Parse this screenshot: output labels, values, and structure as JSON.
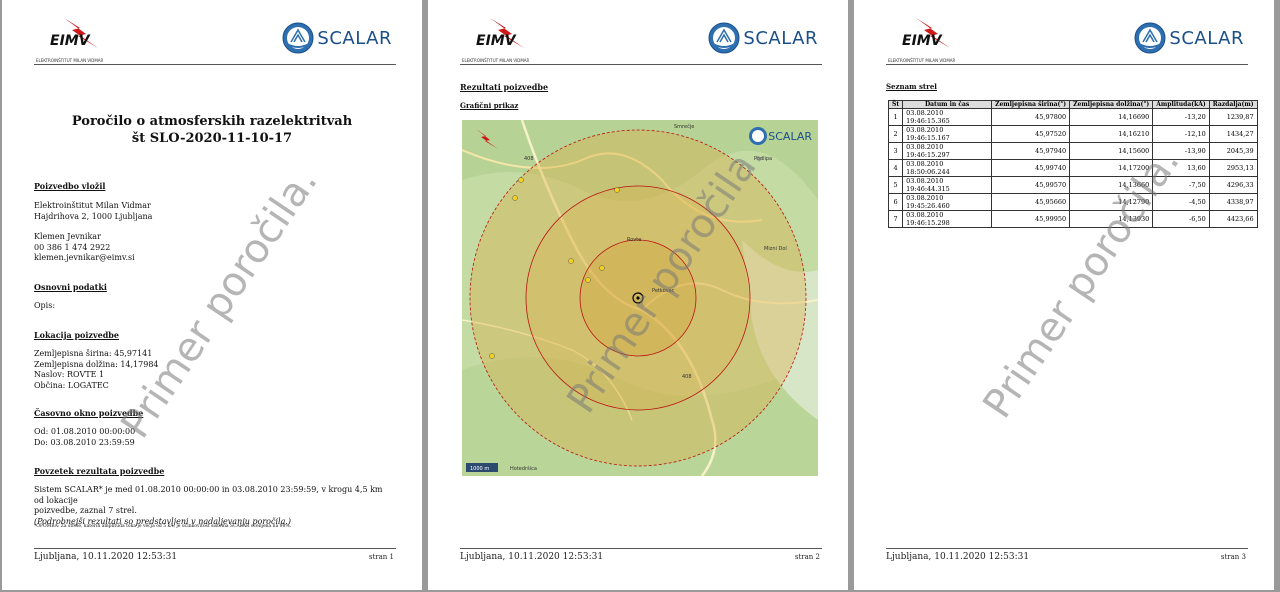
{
  "brand": {
    "eimv": "EIMV",
    "eimv_sub": "ELEKTROINŠTITUT MILAN VIDMAR",
    "scalar": "SCALAR"
  },
  "watermark": "Primer poročila.",
  "page1": {
    "title_line1": "Poročilo o atmosferskih razelektritvah",
    "title_line2": "št SLO-2020-11-10-17",
    "sec_requester": "Poizvedbo vložil",
    "requester_lines": [
      "Elektroinštitut Milan Vidmar",
      "Hajdrihova 2, 1000 Ljubljana"
    ],
    "contact_lines": [
      "Klemen Jevnikar",
      "00 386 1 474 2922",
      "klemen.jevnikar@eimv.si"
    ],
    "sec_basic": "Osnovni podatki",
    "opis": "Opis:",
    "sec_location": "Lokacija poizvedbe",
    "location_lines": [
      "Zemljepisna širina: 45,97141",
      "Zemljepisna dolžina: 14,17984",
      "Naslov: ROVTE 1",
      "Občina: LOGATEC"
    ],
    "sec_time": "Časovno okno poizvedbe",
    "time_lines": [
      "Od: 01.08.2010 00:00:00",
      "Do: 03.08.2010 23:59:59"
    ],
    "sec_summary": "Povzetek rezultata poizvedbe",
    "summary_lines": [
      "Sistem SCALAR* je med 01.08.2010 00:00:00 in 03.08.2010 23:59:59, v krogu 4,5 km od lokacije",
      "poizvedbe, zaznal 7 strel."
    ],
    "summary_italic": "(Podrobnejši rezultati so predstavljeni v nadaljevanju poročila.)",
    "note": "*OPOMBA: Za strele, katerih amplituda toka je večja od 5 kA, je učinkovitost sistema SCALAR ocenjena na 98%.",
    "footer_left": "Ljubljana, 10.11.2020 12:53:31",
    "footer_right": "stran 1"
  },
  "page2": {
    "sec_results": "Rezultati poizvedbe",
    "sec_graphic": "Grafični prikaz",
    "map_labels": {
      "road_top": "408",
      "road_bottom": "408",
      "town_center": "Rovte",
      "town_right": "Mizni Dol",
      "town_ne": "Podlipa",
      "town_mid": "Petkovec",
      "town_bottom": "Hotedršica",
      "town_top": "Smrečje",
      "scale": "1000 m"
    },
    "footer_left": "Ljubljana, 10.11.2020 12:53:31",
    "footer_right": "stran 2"
  },
  "page3": {
    "sec_list": "Seznam strel",
    "headers": [
      "Št",
      "Datum in čas",
      "Zemljepisna širina(°)",
      "Zemljepisna dolžina(°)",
      "Amplituda(kA)",
      "Razdalja(m)"
    ],
    "rows": [
      [
        "1",
        "03.08.2010 19:46:15.365",
        "45,97800",
        "14,16690",
        "-13,20",
        "1239,87"
      ],
      [
        "2",
        "03.08.2010 19:46:15.167",
        "45,97520",
        "14,16210",
        "-12,10",
        "1434,27"
      ],
      [
        "3",
        "03.08.2010 19:46:15.297",
        "45,97940",
        "14,15600",
        "-13,90",
        "2045,39"
      ],
      [
        "4",
        "03.08.2010 18:50:06.244",
        "45,99740",
        "14,17200",
        "13,60",
        "2953,13"
      ],
      [
        "5",
        "03.08.2010 19:46:44.315",
        "45,99570",
        "14,13660",
        "-7,50",
        "4296,33"
      ],
      [
        "6",
        "03.08.2010 19:45:26.460",
        "45,95660",
        "14,12790",
        "-4,50",
        "4338,97"
      ],
      [
        "7",
        "03.08.2010 19:46:15.298",
        "45,99950",
        "14,13930",
        "-6,50",
        "4423,66"
      ]
    ],
    "footer_left": "Ljubljana, 10.11.2020 12:53:31",
    "footer_right": "stran 3"
  }
}
